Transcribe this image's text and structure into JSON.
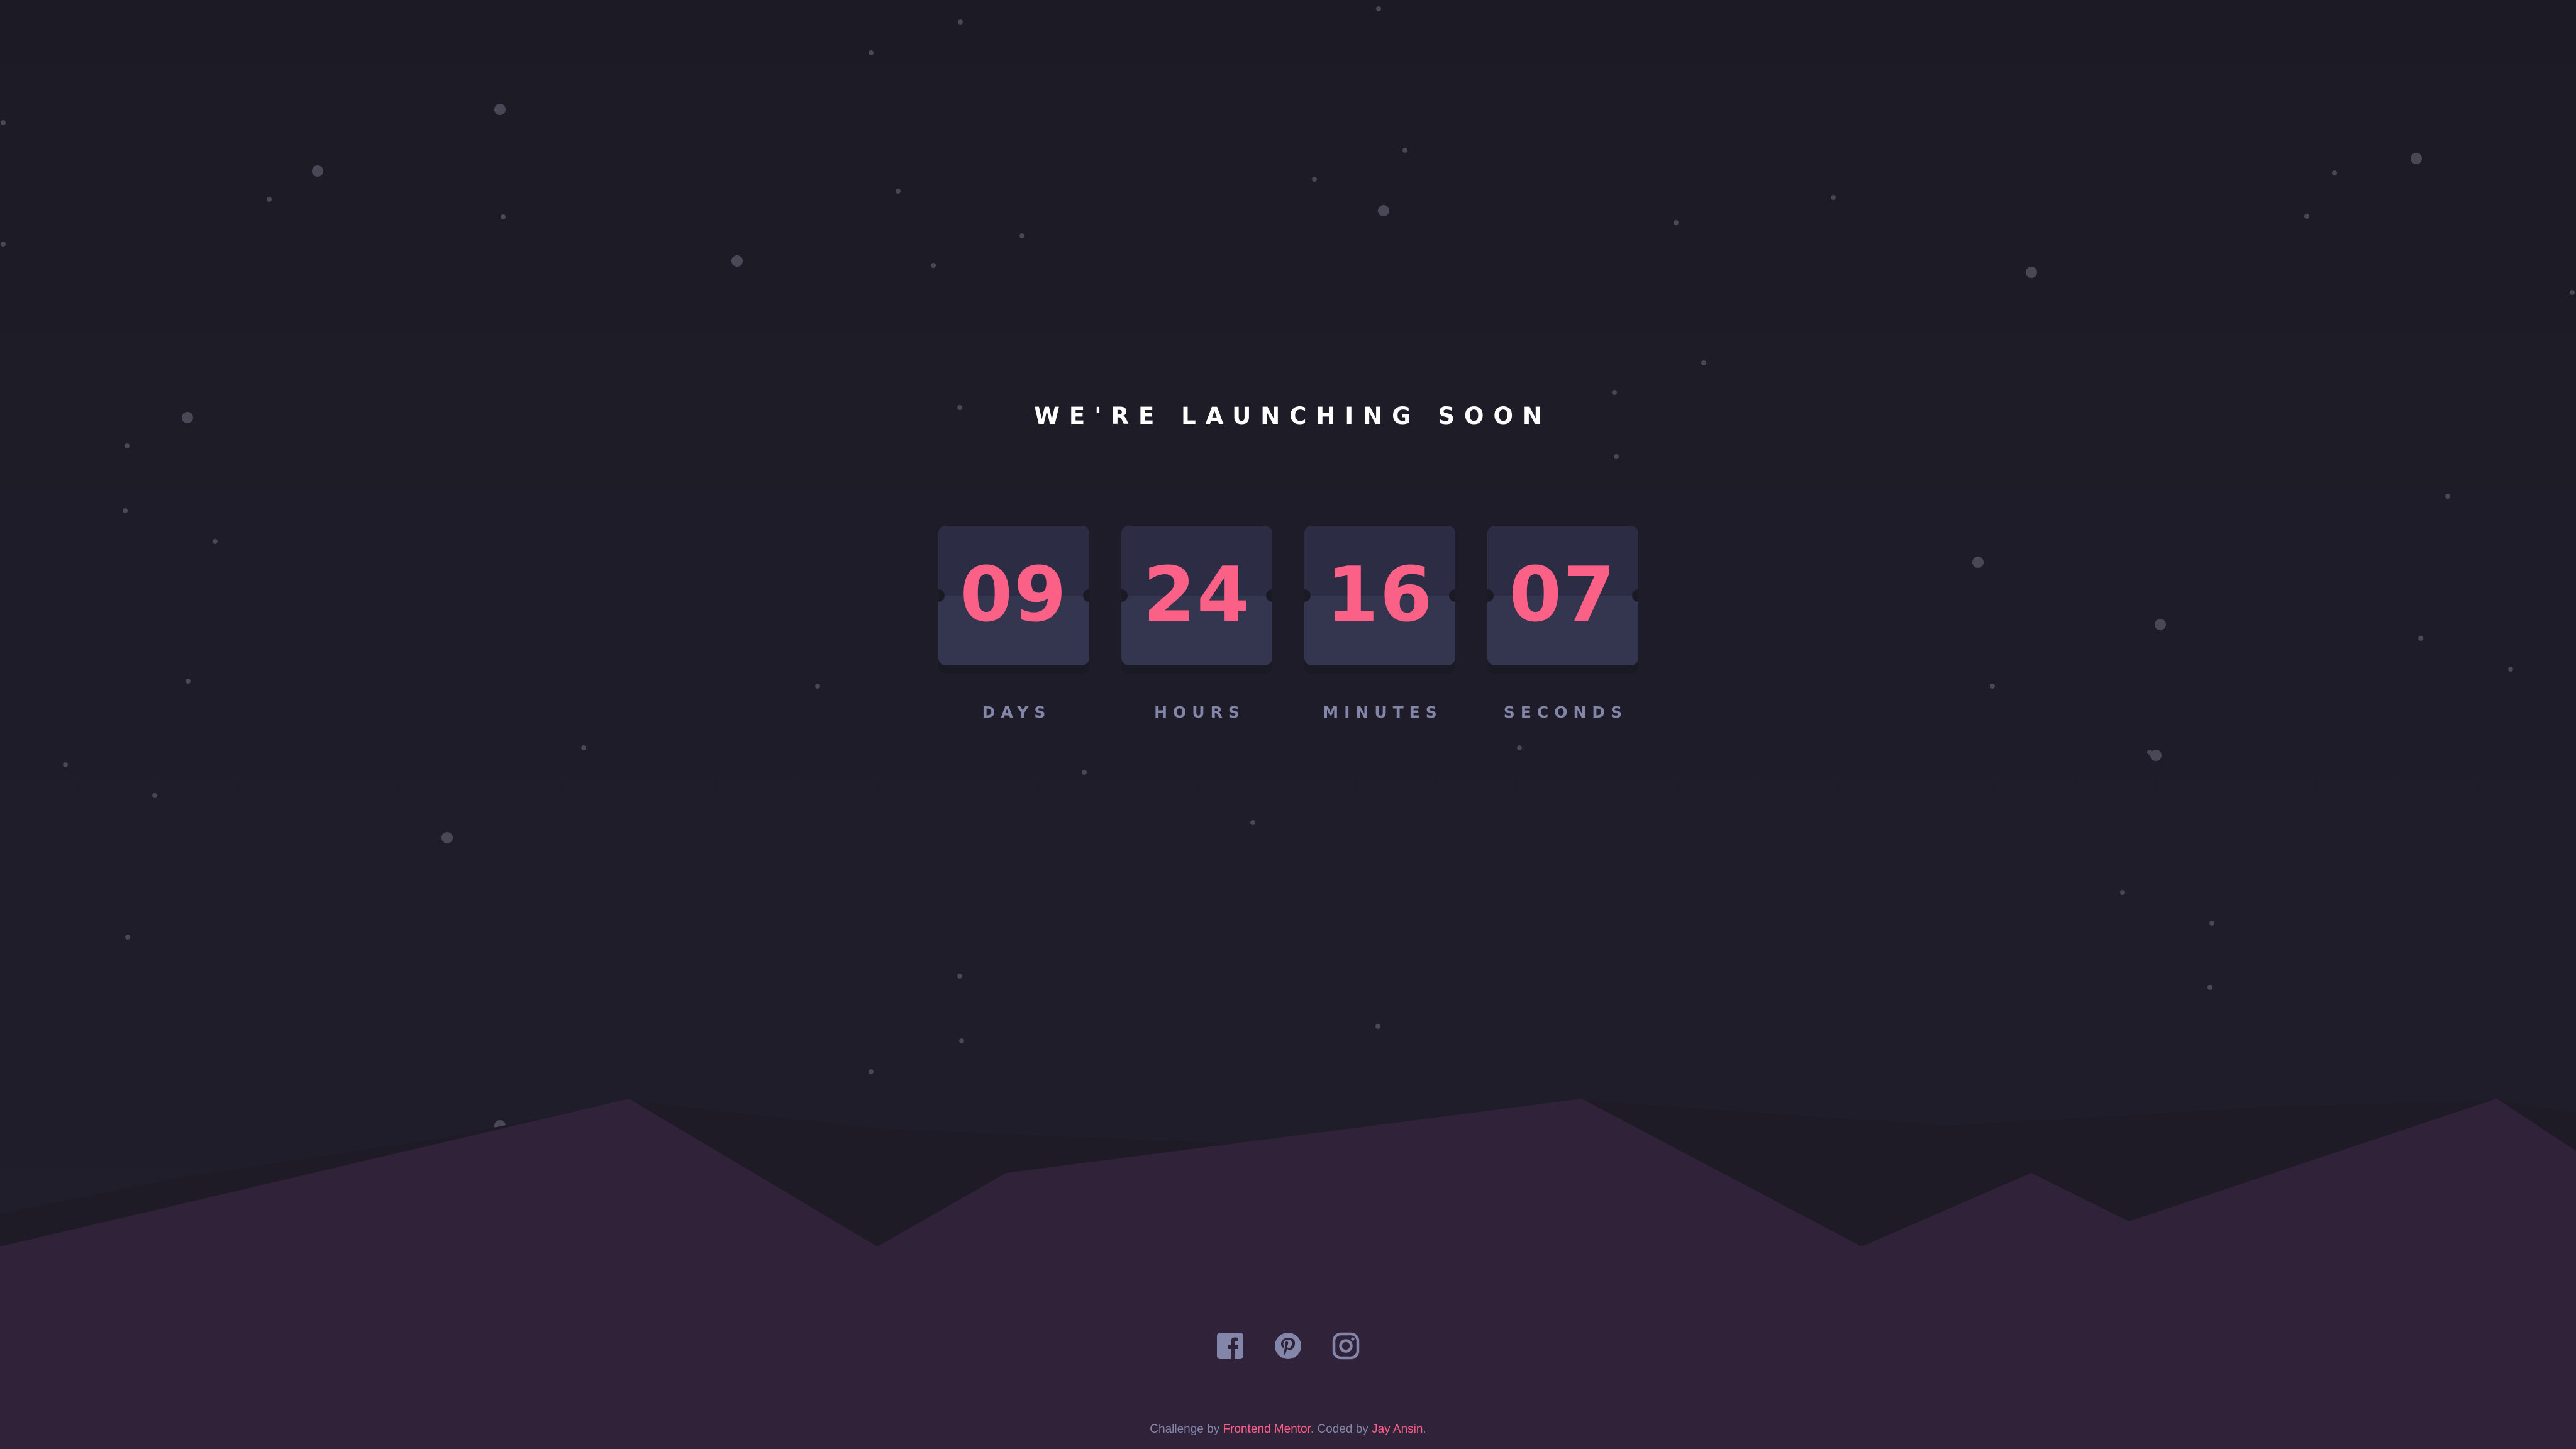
{
  "page": {
    "heading": "WE'RE LAUNCHING SOON"
  },
  "countdown": [
    {
      "value": "09",
      "label": "DAYS"
    },
    {
      "value": "24",
      "label": "HOURS"
    },
    {
      "value": "16",
      "label": "MINUTES"
    },
    {
      "value": "07",
      "label": "SECONDS"
    }
  ],
  "social": [
    {
      "icon": "facebook-icon"
    },
    {
      "icon": "pinterest-icon"
    },
    {
      "icon": "instagram-icon"
    }
  ],
  "footer": {
    "prefix": "Challenge by",
    "link1": "Frontend Mentor",
    "middle": ". Coded by",
    "link2": "Jay Ansin",
    "suffix": "."
  },
  "colors": {
    "background": "#1e1c28",
    "accent": "#fb6087",
    "card": "#343650",
    "label": "#8385a9",
    "hills": "#2f2239"
  }
}
